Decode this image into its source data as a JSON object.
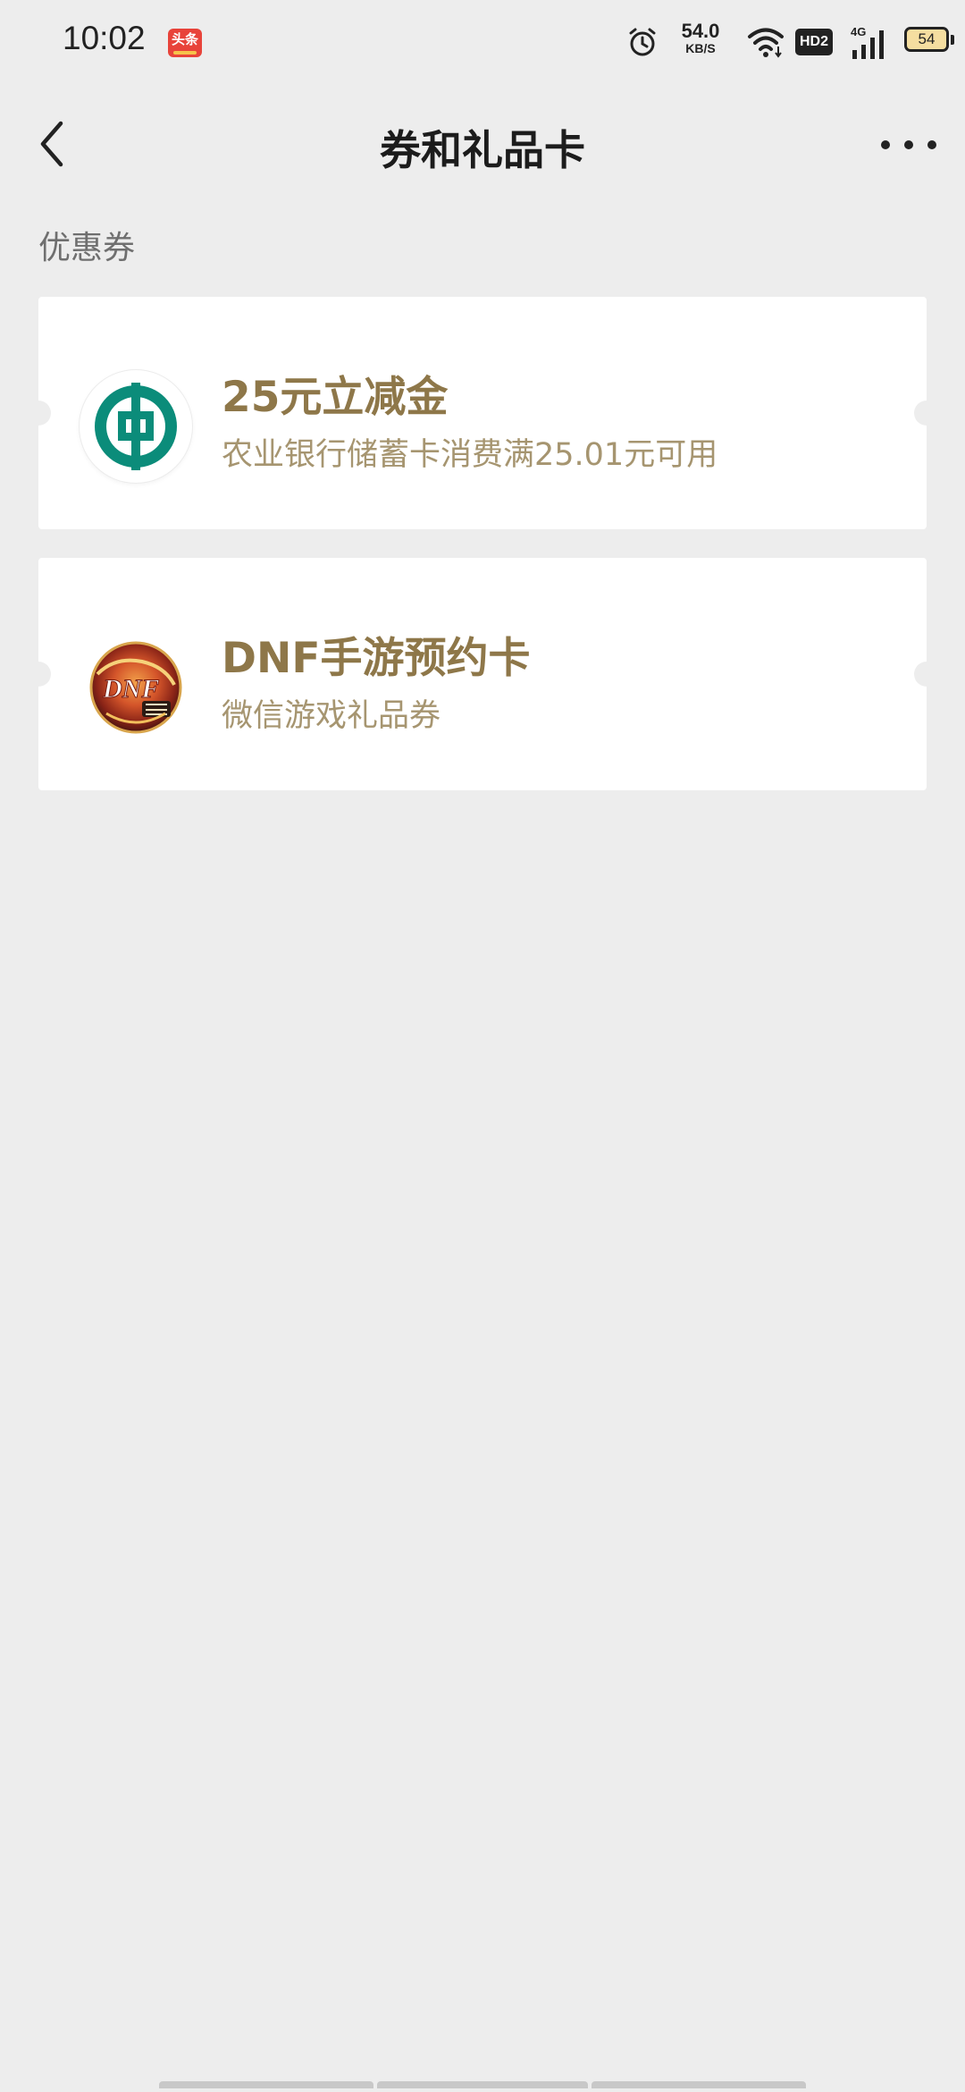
{
  "status_bar": {
    "time": "10:02",
    "app_badge_text": "头条",
    "network_speed_value": "54.0",
    "network_speed_unit": "KB/S",
    "hd_label": "HD2",
    "network_type": "4G",
    "battery_level": "54"
  },
  "nav": {
    "title": "券和礼品卡",
    "back_icon": "chevron-left-icon",
    "more_icon": "more-dots-icon"
  },
  "section": {
    "label": "优惠券"
  },
  "coupons": [
    {
      "title": "25元立减金",
      "subtitle": "农业银行储蓄卡消费满25.01元可用",
      "logo_icon": "abc-bank-logo-icon"
    },
    {
      "title": "DNF手游预约卡",
      "subtitle": "微信游戏礼品券",
      "logo_icon": "dnf-game-logo-icon"
    }
  ],
  "colors": {
    "background": "#ededed",
    "card": "#ffffff",
    "coupon_title": "#8e7749",
    "coupon_subtitle": "#a69570",
    "abc_green": "#0b8c7a"
  }
}
